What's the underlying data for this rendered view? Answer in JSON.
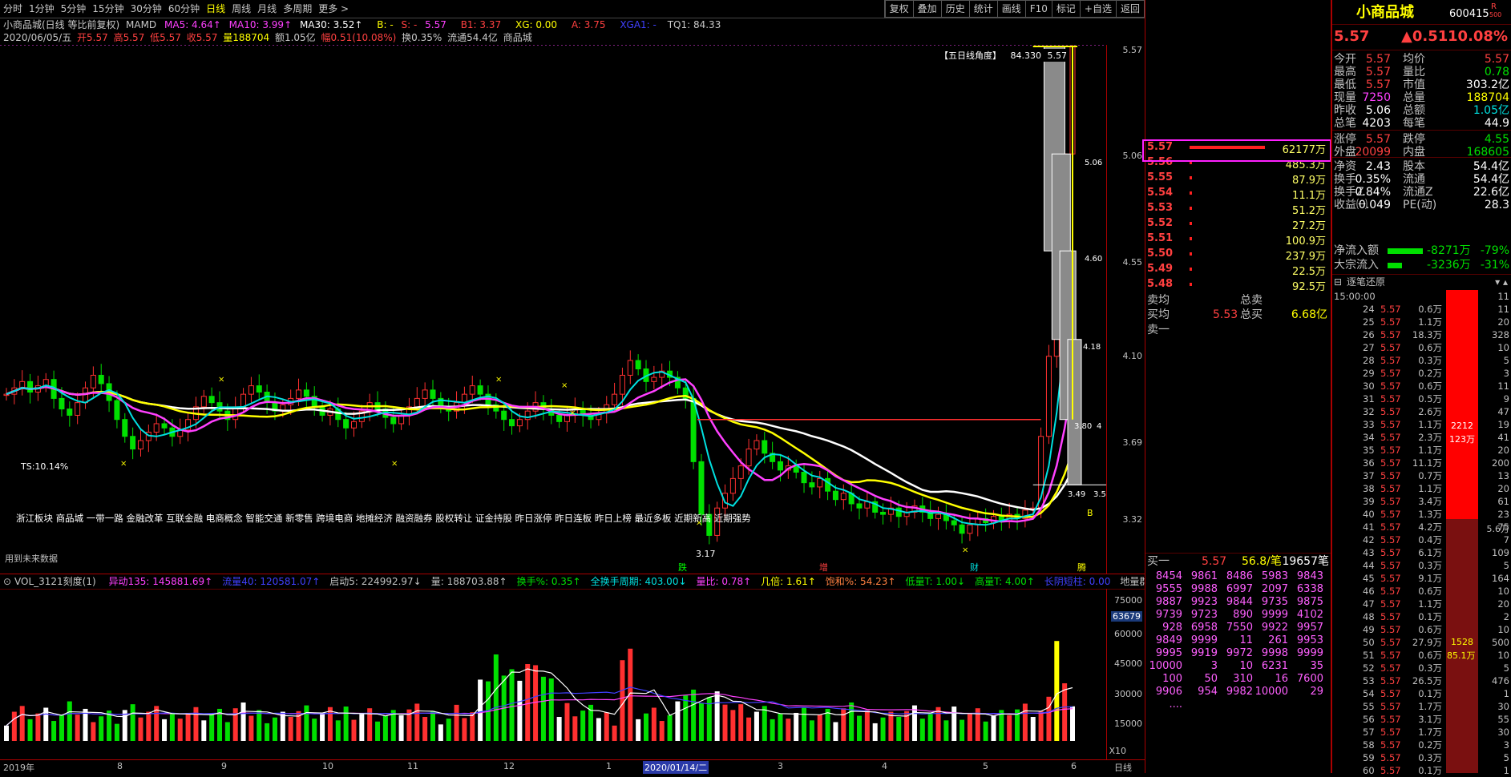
{
  "toolbar": {
    "tabs": [
      "分时",
      "1分钟",
      "5分钟",
      "15分钟",
      "30分钟",
      "60分钟",
      "日线",
      "周线",
      "月线",
      "多周期",
      "更多 >"
    ],
    "active_tab": "日线",
    "right_buttons": [
      "复权",
      "叠加",
      "历史",
      "统计",
      "画线",
      "F10",
      "标记",
      "+自选",
      "返回"
    ]
  },
  "info1": {
    "name": "小商品城(日线 等比前复权)",
    "mamd": "MAMD",
    "ma5": "MA5: 4.64↑",
    "ma10": "MA10: 3.99↑",
    "ma30": "MA30: 3.52↑",
    "b": "B: -",
    "s": "S: -",
    "dash": "5.57",
    "b1": "B1: 3.37",
    "xg": "XG: 0.00",
    "a": "A: 3.75",
    "xga1": "XGA1: -",
    "tq1": "TQ1: 84.33"
  },
  "info2": {
    "date": "2020/06/05/五",
    "open": "开5.57",
    "high": "高5.57",
    "low": "低5.57",
    "close": "收5.57",
    "vol": "量188704",
    "amount": "额1.05亿",
    "change": "幅0.51(10.08%)",
    "turnover": "换0.35%",
    "float": "流通54.4亿",
    "stock": "商品城"
  },
  "main": {
    "angle_label": "【五日线角度】",
    "angle_value": "84.330",
    "top_price": "5.57",
    "ts_label": "TS:10.14%",
    "concepts": "浙江板块 商品城 一带一路 金融改革 互联金融 电商概念 智能交通 新零售 跨境电商 地摊经济  融资融券 股权转让 证金持股 昨日涨停 昨日连板 昨日上榜 最近多板 近期新高 近期强势",
    "future_data": "用到未来数据",
    "low_mark": "3.17",
    "marks": [
      "跌",
      "增",
      "财",
      "腾"
    ],
    "box_labels": [
      "5.06",
      "4.60",
      "4.18",
      "3.80",
      "3.49",
      "3.5",
      "4"
    ],
    "b_mark": "B"
  },
  "price_axis": [
    "5.57",
    "5.06",
    "4.55",
    "4.10",
    "3.69",
    "3.32"
  ],
  "volbar": {
    "name": "VOL_3121刻度(1)",
    "items": [
      {
        "t": "异动135: 145881.69↑",
        "c": "#ff40ff"
      },
      {
        "t": "流量40: 120581.07↑",
        "c": "#4040ff"
      },
      {
        "t": "启动5: 224992.97↓",
        "c": "#c0c0c0"
      },
      {
        "t": "量: 188703.88↑",
        "c": "#c0c0c0"
      },
      {
        "t": "换手%: 0.35↑",
        "c": "#00e000"
      },
      {
        "t": "全换手周期: 403.00↓",
        "c": "#00e0e0"
      },
      {
        "t": "量比: 0.78↑",
        "c": "#ff40ff"
      },
      {
        "t": "几倍: 1.61↑",
        "c": "#ffff00"
      },
      {
        "t": "饱和%: 54.23↑",
        "c": "#ff8040"
      },
      {
        "t": "低量T: 1.00↓",
        "c": "#00e000"
      },
      {
        "t": "高量T: 4.00↑",
        "c": "#00e000"
      },
      {
        "t": "长阴短柱: 0.00",
        "c": "#4040ff"
      },
      {
        "t": "地量群: 0.00",
        "c": "#c0c0c0"
      }
    ]
  },
  "vol_axis": [
    "75000",
    "63679",
    "60000",
    "45000",
    "30000",
    "15000",
    "X10"
  ],
  "dates": [
    "2019年",
    "8",
    "9",
    "10",
    "11",
    "12",
    "1",
    "2020/01/14/二",
    "3",
    "4",
    "5",
    "6",
    "日线"
  ],
  "quote": {
    "name": "小商品城",
    "code": "600415",
    "r_badge": "R",
    "r_sub": "500",
    "price": "5.57",
    "change": "▲0.51",
    "pct": "10.08%",
    "rows": [
      [
        "今开",
        "5.57",
        "均价",
        "5.57"
      ],
      [
        "最高",
        "5.57",
        "量比",
        "0.78"
      ],
      [
        "最低",
        "5.57",
        "市值",
        "303.2亿"
      ],
      [
        "现量",
        "7250",
        "总量",
        "188704"
      ],
      [
        "昨收",
        "5.06",
        "总额",
        "1.05亿"
      ],
      [
        "总笔",
        "4203",
        "每笔",
        "44.9"
      ],
      [
        "涨停",
        "5.57",
        "跌停",
        "4.55"
      ],
      [
        "外盘",
        "20099",
        "内盘",
        "168605"
      ],
      [
        "净资",
        "2.43",
        "股本",
        "54.4亿"
      ],
      [
        "换手",
        "0.35%",
        "流通",
        "54.4亿"
      ],
      [
        "换手Z",
        "0.84%",
        "流通Z",
        "22.6亿"
      ],
      [
        "收益㈠",
        "0.049",
        "PE(动)",
        "28.3"
      ]
    ],
    "netflow_label": "净流入额",
    "netflow_val": "-8271万",
    "netflow_pct": "-79%",
    "bigflow_label": "大宗流入",
    "bigflow_val": "-3236万",
    "bigflow_pct": "-31%"
  },
  "orderbook": {
    "sells": [
      {
        "p": "5.57",
        "v": "62177万",
        "w": 0.78
      },
      {
        "p": "5.56",
        "v": "485.3万",
        "w": 0.01
      },
      {
        "p": "5.55",
        "v": "87.9万",
        "w": 0.01
      },
      {
        "p": "5.54",
        "v": "11.1万",
        "w": 0.01
      },
      {
        "p": "5.53",
        "v": "51.2万",
        "w": 0.01
      },
      {
        "p": "5.52",
        "v": "27.2万",
        "w": 0.01
      },
      {
        "p": "5.51",
        "v": "100.9万",
        "w": 0.01
      },
      {
        "p": "5.50",
        "v": "237.9万",
        "w": 0.01
      },
      {
        "p": "5.49",
        "v": "22.5万",
        "w": 0.01
      },
      {
        "p": "5.48",
        "v": "92.5万",
        "w": 0.01
      }
    ],
    "sell_avg_label": "卖均",
    "sell_total_label": "总卖",
    "buy_avg_label": "买均",
    "buy_avg": "5.53",
    "buy_total_label": "总买",
    "buy_total": "6.68亿",
    "sell1_label": "卖一",
    "buy1_label": "买一",
    "buy1_price": "5.57",
    "buy1_per": "56.8/笔",
    "buy1_total": "19657笔",
    "queue": [
      [
        "8454",
        "9861",
        "8486",
        "5983",
        "9843"
      ],
      [
        "9555",
        "9988",
        "6997",
        "2097",
        "6338"
      ],
      [
        "9887",
        "9923",
        "9844",
        "9735",
        "9875"
      ],
      [
        "9739",
        "9723",
        "890",
        "9999",
        "4102"
      ],
      [
        "928",
        "6958",
        "7550",
        "9922",
        "9957"
      ],
      [
        "9849",
        "9999",
        "11",
        "261",
        "9953"
      ],
      [
        "9995",
        "9919",
        "9972",
        "9998",
        "9999"
      ],
      [
        "10000",
        "3",
        "10",
        "6231",
        "35"
      ],
      [
        "100",
        "50",
        "310",
        "16",
        "7600"
      ],
      [
        "9906",
        "954",
        "9982",
        "10000",
        "29"
      ],
      [
        "....",
        "",
        "",
        "",
        ""
      ]
    ]
  },
  "ticks": {
    "title": "逐笔还原",
    "rows": [
      [
        "15:00:00",
        "",
        "",
        "11"
      ],
      [
        "24",
        "5.57",
        "0.6万",
        "11"
      ],
      [
        "25",
        "5.57",
        "1.1万",
        "20"
      ],
      [
        "26",
        "5.57",
        "18.3万",
        "328"
      ],
      [
        "27",
        "5.57",
        "0.6万",
        "10"
      ],
      [
        "28",
        "5.57",
        "0.3万",
        "5"
      ],
      [
        "29",
        "5.57",
        "0.2万",
        "3"
      ],
      [
        "30",
        "5.57",
        "0.6万",
        "11"
      ],
      [
        "31",
        "5.57",
        "0.5万",
        "9"
      ],
      [
        "32",
        "5.57",
        "2.6万",
        "47"
      ],
      [
        "33",
        "5.57",
        "1.1万",
        "19"
      ],
      [
        "34",
        "5.57",
        "2.3万",
        "41"
      ],
      [
        "35",
        "5.57",
        "1.1万",
        "20"
      ],
      [
        "36",
        "5.57",
        "11.1万",
        "200"
      ],
      [
        "37",
        "5.57",
        "0.7万",
        "13"
      ],
      [
        "38",
        "5.57",
        "1.1万",
        "20"
      ],
      [
        "39",
        "5.57",
        "3.4万",
        "61"
      ],
      [
        "40",
        "5.57",
        "1.3万",
        "23"
      ],
      [
        "41",
        "5.57",
        "4.2万",
        "75"
      ],
      [
        "42",
        "5.57",
        "0.4万",
        "7"
      ],
      [
        "43",
        "5.57",
        "6.1万",
        "109"
      ],
      [
        "44",
        "5.57",
        "0.3万",
        "5"
      ],
      [
        "45",
        "5.57",
        "9.1万",
        "164"
      ],
      [
        "46",
        "5.57",
        "0.6万",
        "10"
      ],
      [
        "47",
        "5.57",
        "1.1万",
        "20"
      ],
      [
        "48",
        "5.57",
        "0.1万",
        "2"
      ],
      [
        "49",
        "5.57",
        "0.6万",
        "10"
      ],
      [
        "50",
        "5.57",
        "27.9万",
        "500"
      ],
      [
        "51",
        "5.57",
        "0.6万",
        "10"
      ],
      [
        "52",
        "5.57",
        "0.3万",
        "5"
      ],
      [
        "53",
        "5.57",
        "26.5万",
        "476"
      ],
      [
        "54",
        "5.57",
        "0.1万",
        "1"
      ],
      [
        "55",
        "5.57",
        "1.7万",
        "30"
      ],
      [
        "56",
        "5.57",
        "3.1万",
        "55"
      ],
      [
        "57",
        "5.57",
        "1.7万",
        "30"
      ],
      [
        "58",
        "5.57",
        "0.2万",
        "3"
      ],
      [
        "59",
        "5.57",
        "0.3万",
        "5"
      ],
      [
        "60",
        "5.57",
        "0.1万",
        "1"
      ]
    ],
    "bar1_count": "2212",
    "bar1_amount": "123万",
    "bar2_count": "1528",
    "bar2_amount": "85.1万",
    "side_label": "5.6万"
  },
  "chart_data": {
    "type": "candlestick",
    "title": "小商品城(日线 等比前复权)",
    "price_ticks": [
      5.57,
      5.06,
      4.55,
      4.1,
      3.69,
      3.32
    ],
    "ylim": [
      3.1,
      5.6
    ],
    "date_ticks": [
      "2019年",
      "8",
      "9",
      "10",
      "11",
      "12",
      "1",
      "2020/01/14/二",
      "3",
      "4",
      "5",
      "6"
    ],
    "close": [
      3.92,
      3.95,
      3.98,
      3.93,
      3.96,
      3.99,
      3.9,
      3.85,
      3.82,
      3.88,
      3.95,
      4.01,
      3.97,
      3.89,
      3.8,
      3.72,
      3.66,
      3.7,
      3.74,
      3.78,
      3.76,
      3.72,
      3.75,
      3.8,
      3.86,
      3.91,
      3.88,
      3.84,
      3.8,
      3.86,
      3.92,
      3.96,
      3.93,
      3.88,
      3.84,
      3.87,
      3.9,
      3.94,
      3.91,
      3.86,
      3.82,
      3.85,
      3.8,
      3.76,
      3.79,
      3.84,
      3.88,
      3.85,
      3.81,
      3.78,
      3.82,
      3.86,
      3.9,
      3.94,
      3.9,
      3.86,
      3.84,
      3.88,
      3.92,
      3.96,
      3.92,
      3.87,
      3.84,
      3.8,
      3.77,
      3.8,
      3.84,
      3.88,
      3.85,
      3.82,
      3.79,
      3.82,
      3.85,
      3.82,
      3.8,
      3.83,
      3.87,
      3.92,
      4.01,
      4.08,
      4.04,
      3.98,
      4.0,
      4.03,
      4.0,
      3.95,
      3.9,
      3.6,
      3.35,
      3.25,
      3.38,
      3.45,
      3.52,
      3.58,
      3.66,
      3.7,
      3.64,
      3.6,
      3.56,
      3.58,
      3.55,
      3.5,
      3.48,
      3.52,
      3.46,
      3.42,
      3.45,
      3.4,
      3.38,
      3.41,
      3.36,
      3.35,
      3.38,
      3.34,
      3.36,
      3.39,
      3.36,
      3.33,
      3.35,
      3.32,
      3.3,
      3.26,
      3.3,
      3.33,
      3.31,
      3.34,
      3.32,
      3.35,
      3.33,
      3.37,
      3.38,
      3.72,
      4.1,
      4.6,
      5.06,
      5.57
    ],
    "ma5_last": 4.64,
    "ma10_last": 3.99,
    "ma30_last": 3.52,
    "volume_ticks": [
      75000,
      60000,
      45000,
      30000,
      15000
    ]
  }
}
